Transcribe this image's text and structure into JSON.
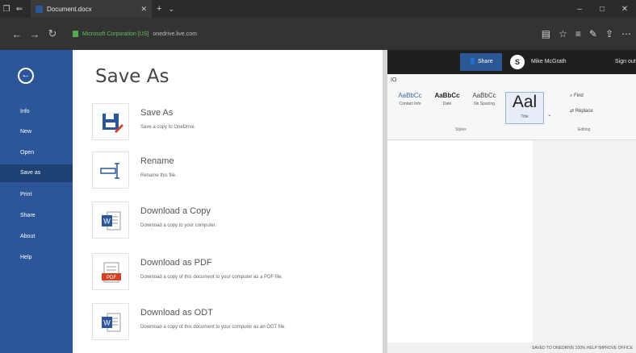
{
  "browser": {
    "tab_title": "Document.docx",
    "site_label": "Microsoft Corporation [US]",
    "url": "onedrive.live.com"
  },
  "rail": {
    "back_glyph": "←",
    "items": [
      {
        "label": "Info"
      },
      {
        "label": "New"
      },
      {
        "label": "Open"
      },
      {
        "label": "Save as"
      },
      {
        "label": "Print"
      },
      {
        "label": "Share"
      },
      {
        "label": "About"
      },
      {
        "label": "Help"
      }
    ],
    "selected": "Save as"
  },
  "panel": {
    "title": "Save As",
    "options": [
      {
        "name": "Save As",
        "desc": "Save a copy to OneDrive.",
        "icon": "save-as-icon"
      },
      {
        "name": "Rename",
        "desc": "Rename this file.",
        "icon": "rename-icon"
      },
      {
        "name": "Download a Copy",
        "desc": "Download a copy to your computer.",
        "icon": "word-doc-icon"
      },
      {
        "name": "Download as PDF",
        "desc": "Download a copy of this document to your computer as a PDF file.",
        "icon": "pdf-icon"
      },
      {
        "name": "Download as ODT",
        "desc": "Download a copy of this document to your computer as an ODT file.",
        "icon": "word-doc-icon"
      }
    ]
  },
  "doc": {
    "share_label": "Share",
    "user_name": "Mike McGrath",
    "signout_label": "Sign out",
    "ribbon_tab": "IO",
    "styles": [
      {
        "preview": "AaBbCc",
        "name": "Contact Info"
      },
      {
        "preview": "AaBbCc",
        "name": "Date"
      },
      {
        "preview": "AaBbCc",
        "name": "No Spacing"
      },
      {
        "preview": "Aal",
        "name": "Title"
      }
    ],
    "find_label": "Find",
    "replace_label": "Replace",
    "styles_group": "Styles",
    "editing_group": "Editing",
    "status_text": "SAVED TO ONEDRIVE    100%    HELP IMPROVE OFFICE"
  }
}
